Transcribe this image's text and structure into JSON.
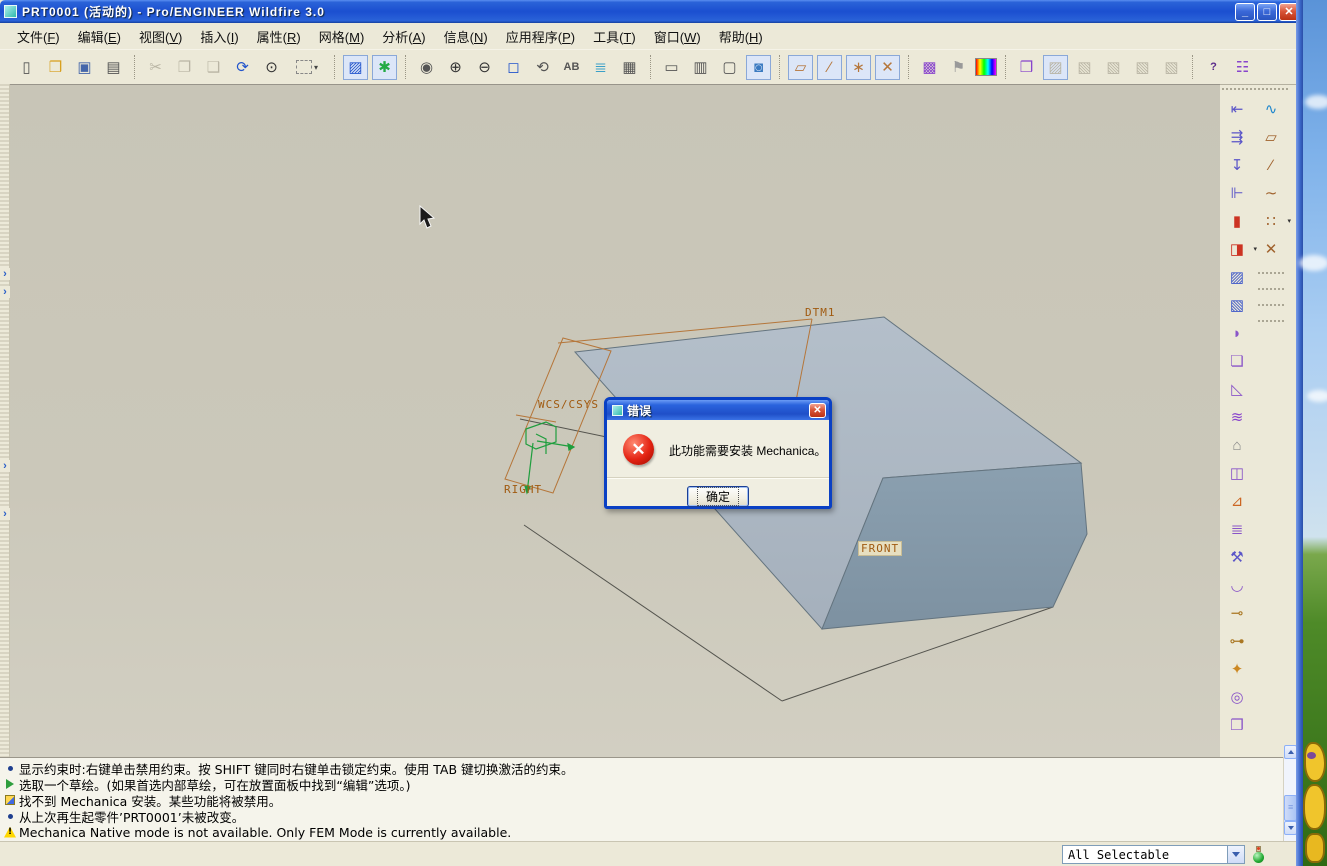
{
  "window": {
    "title": "PRT0001 (活动的) - Pro/ENGINEER Wildfire 3.0",
    "minimize_label": "_",
    "maximize_label": "□",
    "close_label": "✕"
  },
  "menu_bar": {
    "items": [
      {
        "text": "文件",
        "mnemonic": "F"
      },
      {
        "text": "编辑",
        "mnemonic": "E"
      },
      {
        "text": "视图",
        "mnemonic": "V"
      },
      {
        "text": "插入",
        "mnemonic": "I"
      },
      {
        "text": "属性",
        "mnemonic": "R"
      },
      {
        "text": "网格",
        "mnemonic": "M"
      },
      {
        "text": "分析",
        "mnemonic": "A"
      },
      {
        "text": "信息",
        "mnemonic": "N"
      },
      {
        "text": "应用程序",
        "mnemonic": "P"
      },
      {
        "text": "工具",
        "mnemonic": "T"
      },
      {
        "text": "窗口",
        "mnemonic": "W"
      },
      {
        "text": "帮助",
        "mnemonic": "H"
      }
    ]
  },
  "toolbar": {
    "groups": [
      [
        {
          "name": "new-file-button",
          "glyph": "▯",
          "color": "#555"
        },
        {
          "name": "open-file-button",
          "glyph": "❒",
          "color": "#d8a020"
        },
        {
          "name": "save-button",
          "glyph": "▣",
          "color": "#4466aa"
        },
        {
          "name": "print-button",
          "glyph": "▤",
          "color": "#555"
        }
      ],
      [
        {
          "name": "cut-button",
          "glyph": "✂",
          "state": "disabled"
        },
        {
          "name": "copy-button",
          "glyph": "❐",
          "state": "disabled"
        },
        {
          "name": "paste-button",
          "glyph": "❑",
          "state": "disabled"
        },
        {
          "name": "regenerate-button",
          "glyph": "⟳",
          "color": "#2255cc"
        },
        {
          "name": "find-button",
          "glyph": "⊙",
          "color": "#333"
        },
        {
          "name": "selection-filter-box",
          "kind": "selbox"
        }
      ],
      [
        {
          "name": "sketcher-display-toggle",
          "glyph": "▨",
          "color": "#2255cc",
          "state": "pressed"
        },
        {
          "name": "spin-center-toggle",
          "glyph": "✱",
          "color": "#22aa44",
          "state": "pressed"
        }
      ],
      [
        {
          "name": "orient-mode-button",
          "glyph": "◉",
          "color": "#555"
        },
        {
          "name": "zoom-in-button",
          "glyph": "⊕",
          "color": "#333"
        },
        {
          "name": "zoom-out-button",
          "glyph": "⊖",
          "color": "#333"
        },
        {
          "name": "refit-button",
          "glyph": "◻",
          "color": "#2255cc"
        },
        {
          "name": "reorient-button",
          "glyph": "⟲",
          "color": "#555"
        },
        {
          "name": "saved-views-button",
          "glyph": "AB",
          "kind": "text",
          "color": "#555"
        },
        {
          "name": "layers-button",
          "glyph": "≣",
          "color": "#3aa0c8"
        },
        {
          "name": "view-manager-button",
          "glyph": "▦",
          "color": "#555"
        }
      ],
      [
        {
          "name": "wireframe-button",
          "glyph": "▭",
          "color": "#555"
        },
        {
          "name": "hidden-line-button",
          "glyph": "▥",
          "color": "#555"
        },
        {
          "name": "no-hidden-button",
          "glyph": "▢",
          "color": "#555"
        },
        {
          "name": "shaded-button",
          "glyph": "◙",
          "color": "#3a7ac0",
          "state": "pressed"
        }
      ],
      [
        {
          "name": "datum-plane-display-toggle",
          "glyph": "▱",
          "color": "#b5763a",
          "state": "pressed"
        },
        {
          "name": "datum-axis-display-toggle",
          "glyph": "∕",
          "color": "#b5763a",
          "state": "pressed"
        },
        {
          "name": "point-display-toggle",
          "glyph": "∗",
          "color": "#b5763a",
          "state": "pressed"
        },
        {
          "name": "csys-display-toggle",
          "glyph": "✕",
          "color": "#b5763a",
          "state": "pressed"
        }
      ],
      [
        {
          "name": "mesh-display-button",
          "glyph": "▩",
          "color": "#8844cc"
        },
        {
          "name": "flag-button",
          "glyph": "⚑",
          "color": "#999"
        },
        {
          "name": "result-window-button",
          "kind": "rainbow"
        }
      ],
      [
        {
          "name": "simulation-objects-button",
          "glyph": "❒",
          "color": "#8844cc"
        },
        {
          "name": "sim-select-button",
          "glyph": "▨",
          "state": "disabled pressed"
        },
        {
          "name": "sim-copy-button",
          "glyph": "▧",
          "state": "disabled"
        },
        {
          "name": "sim-move-button",
          "glyph": "▧",
          "state": "disabled"
        },
        {
          "name": "sim-mirror-button",
          "glyph": "▧",
          "state": "disabled"
        },
        {
          "name": "sim-pattern-button",
          "glyph": "▧",
          "state": "disabled"
        }
      ],
      [
        {
          "name": "context-help-button",
          "glyph": "?",
          "kind": "text",
          "color": "#5a2a8a"
        },
        {
          "name": "message-log-button",
          "glyph": "☷",
          "color": "#8844cc"
        }
      ]
    ]
  },
  "right_toolbar": {
    "col1": [
      {
        "name": "displacement-constraint-button",
        "glyph": "⇤",
        "color": "#5a55c8"
      },
      {
        "name": "force-moment-load-button",
        "glyph": "⇶",
        "color": "#5a55c8"
      },
      {
        "name": "pressure-load-button",
        "glyph": "↧",
        "color": "#5a55c8"
      },
      {
        "name": "fixed-constraint-button",
        "glyph": "⊩",
        "color": "#5a55c8"
      },
      {
        "name": "temperature-load-button",
        "glyph": "▮",
        "color": "#cc3322"
      },
      {
        "name": "convection-condition-button",
        "glyph": "◨",
        "color": "#cc3322",
        "dropdown": true
      },
      {
        "name": "symmetry-constraint-button",
        "glyph": "▨",
        "color": "#3a55c8"
      },
      {
        "name": "mirror-symmetry-button",
        "glyph": "▧",
        "color": "#3a55c8"
      },
      {
        "name": "shell-idealization-button",
        "glyph": "◗",
        "color": "#8a55c8"
      },
      {
        "name": "shell-pair-button",
        "glyph": "❏",
        "color": "#8a55c8"
      },
      {
        "name": "beam-idealization-button",
        "glyph": "◺",
        "color": "#8a55c8"
      },
      {
        "name": "spring-idealization-button",
        "glyph": "≋",
        "color": "#8a44cc"
      },
      {
        "name": "mass-idealization-button",
        "glyph": "⌂",
        "color": "#888"
      },
      {
        "name": "interface-connection-button",
        "glyph": "◫",
        "color": "#8a55c8"
      },
      {
        "name": "beam-section-button",
        "glyph": "⊿",
        "color": "#cc6622"
      },
      {
        "name": "rigid-link-button",
        "glyph": "≣",
        "color": "#8a55c8"
      },
      {
        "name": "spot-weld-button",
        "glyph": "⚒",
        "color": "#5a55c8"
      },
      {
        "name": "contact-region-button",
        "glyph": "◡",
        "color": "#8a55c8"
      },
      {
        "name": "measure-tag-button",
        "glyph": "⊸",
        "color": "#aa7722"
      },
      {
        "name": "tag-region-button",
        "glyph": "⊶",
        "color": "#aa7722"
      },
      {
        "name": "mesh-control-button",
        "glyph": "✦",
        "color": "#cc8822"
      },
      {
        "name": "shell-region-button",
        "glyph": "◎",
        "color": "#8a55c8"
      },
      {
        "name": "volume-region-button",
        "glyph": "❒",
        "color": "#8a55c8"
      }
    ],
    "col2": [
      {
        "name": "spline-tool-button",
        "glyph": "∿",
        "color": "#2288cc"
      },
      {
        "name": "rectangle-tool-button",
        "glyph": "▱",
        "color": "#a0622d"
      },
      {
        "name": "line-tool-button",
        "glyph": "∕",
        "color": "#a0622d"
      },
      {
        "name": "curve-tool-button",
        "glyph": "∼",
        "color": "#a0622d"
      },
      {
        "name": "point-tool-button",
        "glyph": "∷",
        "color": "#a0622d",
        "dropdown": true
      },
      {
        "name": "csys-tool-button",
        "glyph": "✕",
        "color": "#a0622d"
      },
      {
        "kind": "sep"
      },
      {
        "kind": "sep"
      },
      {
        "kind": "sep"
      },
      {
        "kind": "sep"
      }
    ]
  },
  "canvas": {
    "labels": [
      "DTM1",
      "WCS/CSYS",
      "RIGHT",
      "FRONT"
    ]
  },
  "dialog": {
    "title": "错误",
    "message": "此功能需要安装 Mechanica。",
    "ok_label": "确定"
  },
  "messages": {
    "lines": [
      {
        "icon": "bullet",
        "text": "显示约束时:右键单击禁用约束。按 SHIFT 键同时右键单击锁定约束。使用 TAB 键切换激活的约束。"
      },
      {
        "icon": "green-arrow",
        "text": "选取一个草绘。(如果首选内部草绘，可在放置面板中找到“编辑”选项。)"
      },
      {
        "icon": "notice",
        "text": "找不到 Mechanica 安装。某些功能将被禁用。"
      },
      {
        "icon": "bullet",
        "text": "从上次再生起零件’PRT0001’未被改变。"
      },
      {
        "icon": "warning",
        "text": "Mechanica Native mode is not available. Only FEM Mode is currently available."
      }
    ]
  },
  "status_bar": {
    "selector_value": "All Selectable"
  }
}
